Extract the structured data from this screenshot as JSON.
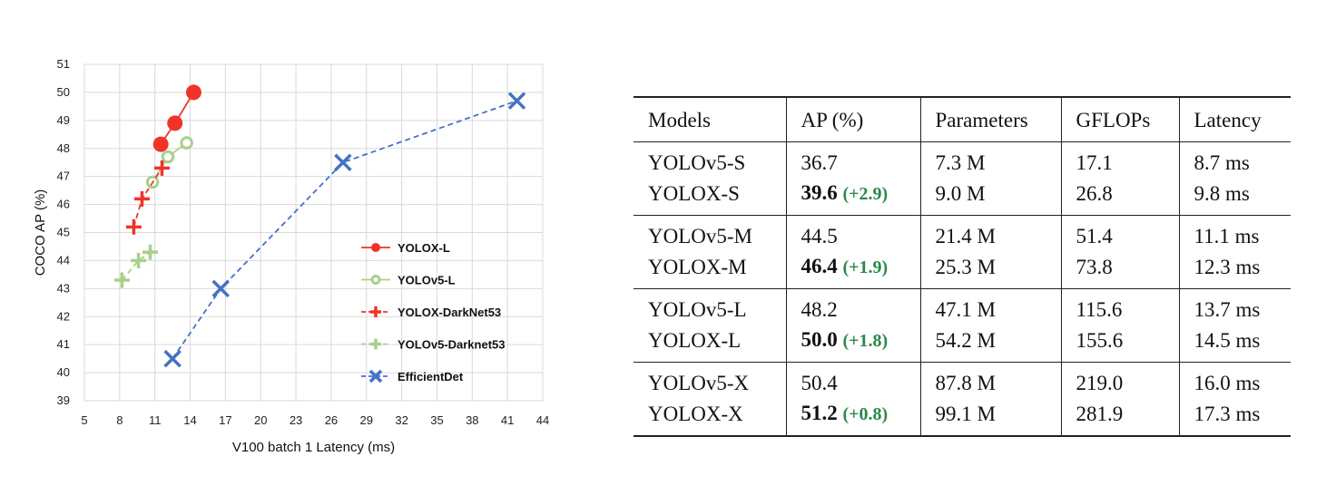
{
  "chart_data": {
    "type": "line",
    "xlabel": "V100 batch 1 Latency (ms)",
    "ylabel": "COCO AP (%)",
    "xlim": [
      5,
      44
    ],
    "ylim": [
      39,
      51
    ],
    "xticks": [
      "5",
      "8",
      "11",
      "14",
      "17",
      "20",
      "23",
      "26",
      "29",
      "32",
      "35",
      "38",
      "41",
      "44"
    ],
    "yticks": [
      "39",
      "40",
      "41",
      "42",
      "43",
      "44",
      "45",
      "46",
      "47",
      "48",
      "49",
      "50",
      "51"
    ],
    "grid": true,
    "legend_position": "right-center",
    "series": [
      {
        "name": "YOLOX-L",
        "color": "#f0332a",
        "line": "solid",
        "marker": "filled-circle",
        "points": [
          [
            11.5,
            48.15
          ],
          [
            12.7,
            48.9
          ],
          [
            14.3,
            50.0
          ]
        ]
      },
      {
        "name": "YOLOv5-L",
        "color": "#a9cf8c",
        "line": "solid",
        "marker": "open-circle",
        "points": [
          [
            10.8,
            46.8
          ],
          [
            12.1,
            47.7
          ],
          [
            13.7,
            48.2
          ]
        ]
      },
      {
        "name": "YOLOX-DarkNet53",
        "color": "#f0332a",
        "line": "dashed",
        "marker": "plus",
        "points": [
          [
            9.2,
            45.2
          ],
          [
            9.9,
            46.2
          ],
          [
            11.6,
            47.3
          ]
        ]
      },
      {
        "name": "YOLOv5-Darknet53",
        "color": "#a9cf8c",
        "line": "dashed",
        "marker": "plus",
        "points": [
          [
            8.2,
            43.3
          ],
          [
            9.6,
            44.0
          ],
          [
            10.6,
            44.3
          ]
        ]
      },
      {
        "name": "EfficientDet",
        "color": "#4472c4",
        "line": "dashed",
        "marker": "x",
        "points": [
          [
            12.5,
            40.5
          ],
          [
            16.6,
            43.0
          ],
          [
            27.0,
            47.5
          ],
          [
            41.8,
            49.7
          ]
        ]
      }
    ]
  },
  "table": {
    "headers": [
      "Models",
      "AP (%)",
      "Parameters",
      "GFLOPs",
      "Latency"
    ],
    "groups": [
      [
        {
          "model": "YOLOv5-S",
          "ap": "36.7",
          "gain": "",
          "params": "7.3 M",
          "gflops": "17.1",
          "latency": "8.7 ms"
        },
        {
          "model": "YOLOX-S",
          "ap": "39.6",
          "gain": "(+2.9)",
          "params": "9.0 M",
          "gflops": "26.8",
          "latency": "9.8 ms"
        }
      ],
      [
        {
          "model": "YOLOv5-M",
          "ap": "44.5",
          "gain": "",
          "params": "21.4 M",
          "gflops": "51.4",
          "latency": "11.1 ms"
        },
        {
          "model": "YOLOX-M",
          "ap": "46.4",
          "gain": "(+1.9)",
          "params": "25.3 M",
          "gflops": "73.8",
          "latency": "12.3 ms"
        }
      ],
      [
        {
          "model": "YOLOv5-L",
          "ap": "48.2",
          "gain": "",
          "params": "47.1 M",
          "gflops": "115.6",
          "latency": "13.7 ms"
        },
        {
          "model": "YOLOX-L",
          "ap": "50.0",
          "gain": "(+1.8)",
          "params": "54.2 M",
          "gflops": "155.6",
          "latency": "14.5 ms"
        }
      ],
      [
        {
          "model": "YOLOv5-X",
          "ap": "50.4",
          "gain": "",
          "params": "87.8 M",
          "gflops": "219.0",
          "latency": "16.0 ms"
        },
        {
          "model": "YOLOX-X",
          "ap": "51.2",
          "gain": "(+0.8)",
          "params": "99.1 M",
          "gflops": "281.9",
          "latency": "17.3 ms"
        }
      ]
    ]
  }
}
